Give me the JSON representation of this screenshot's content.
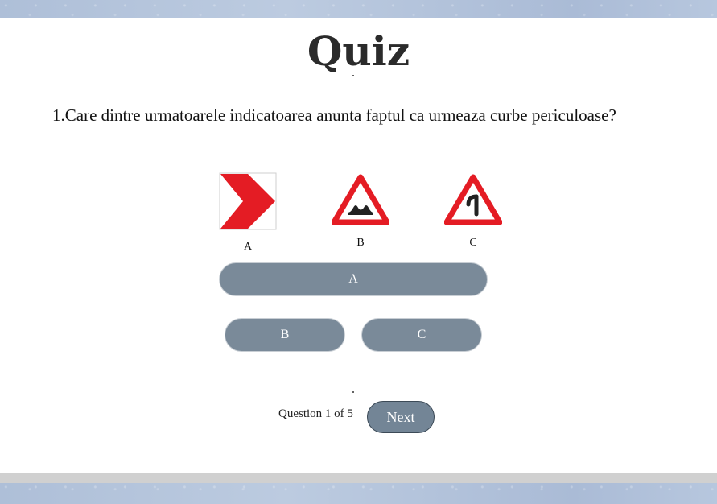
{
  "quiz": {
    "title": "Quiz",
    "question": "1.Care dintre urmatoarele indicatoarea anunta faptul ca urmeaza curbe periculoase?",
    "signs": [
      {
        "label": "A",
        "icon": "chevron-right-sign-icon"
      },
      {
        "label": "B",
        "icon": "uneven-road-warning-sign-icon"
      },
      {
        "label": "C",
        "icon": "dangerous-curve-warning-sign-icon"
      }
    ],
    "answers": {
      "a": "A",
      "b": "B",
      "c": "C"
    },
    "counter": "Question 1 of 5",
    "next_label": "Next"
  },
  "colors": {
    "answer_button": "#7a8a99",
    "next_button": "#738596",
    "sign_red": "#e41c24",
    "background": "#b4c3da"
  }
}
